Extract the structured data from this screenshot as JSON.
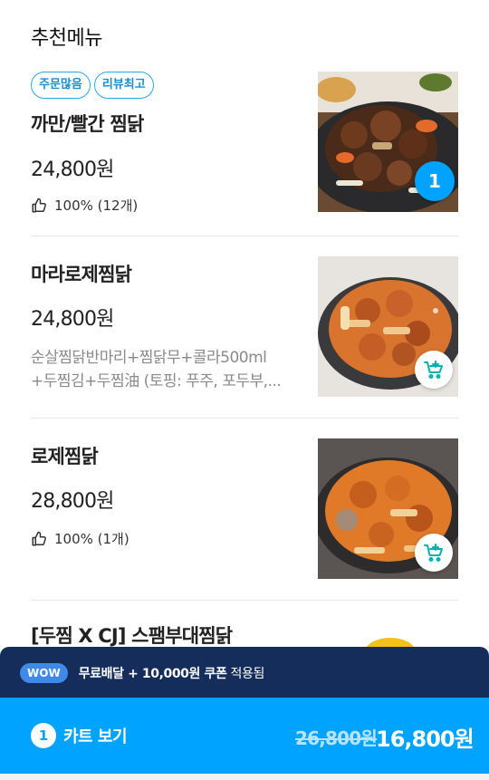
{
  "section": {
    "title": "추천메뉴"
  },
  "items": [
    {
      "tags": [
        "주문많음",
        "리뷰최고"
      ],
      "name": "까만/빨간 찜닭",
      "price": "24,800원",
      "rating": "100% (12개)",
      "cart_qty": "1",
      "image_icon": "braised-chicken-dark-image"
    },
    {
      "name": "마라로제찜닭",
      "price": "24,800원",
      "desc_line1": "순살찜닭반마리+찜닭무+콜라500ml",
      "desc_line2": "+두찜김+두찜油 (토핑: 푸주, 포두부,...",
      "image_icon": "mala-rose-chicken-image",
      "action_icon": "add-to-cart-icon"
    },
    {
      "name": "로제찜닭",
      "price": "28,800원",
      "rating": "100% (1개)",
      "image_icon": "rose-chicken-image",
      "action_icon": "add-to-cart-icon"
    },
    {
      "name": "[두찜 X CJ] 스팸부대찜닭"
    }
  ],
  "wow": {
    "badge": "WOW",
    "text_bold": "무료배달 + 10,000원 쿠폰",
    "text_light": " 적용됨"
  },
  "cart": {
    "count": "1",
    "label": "카트 보기",
    "original_price": "26,800원",
    "final_price": "16,800원"
  },
  "colors": {
    "accent": "#00a3ff",
    "wow_bar": "#142d5b",
    "tag_border": "#29a8e8"
  }
}
